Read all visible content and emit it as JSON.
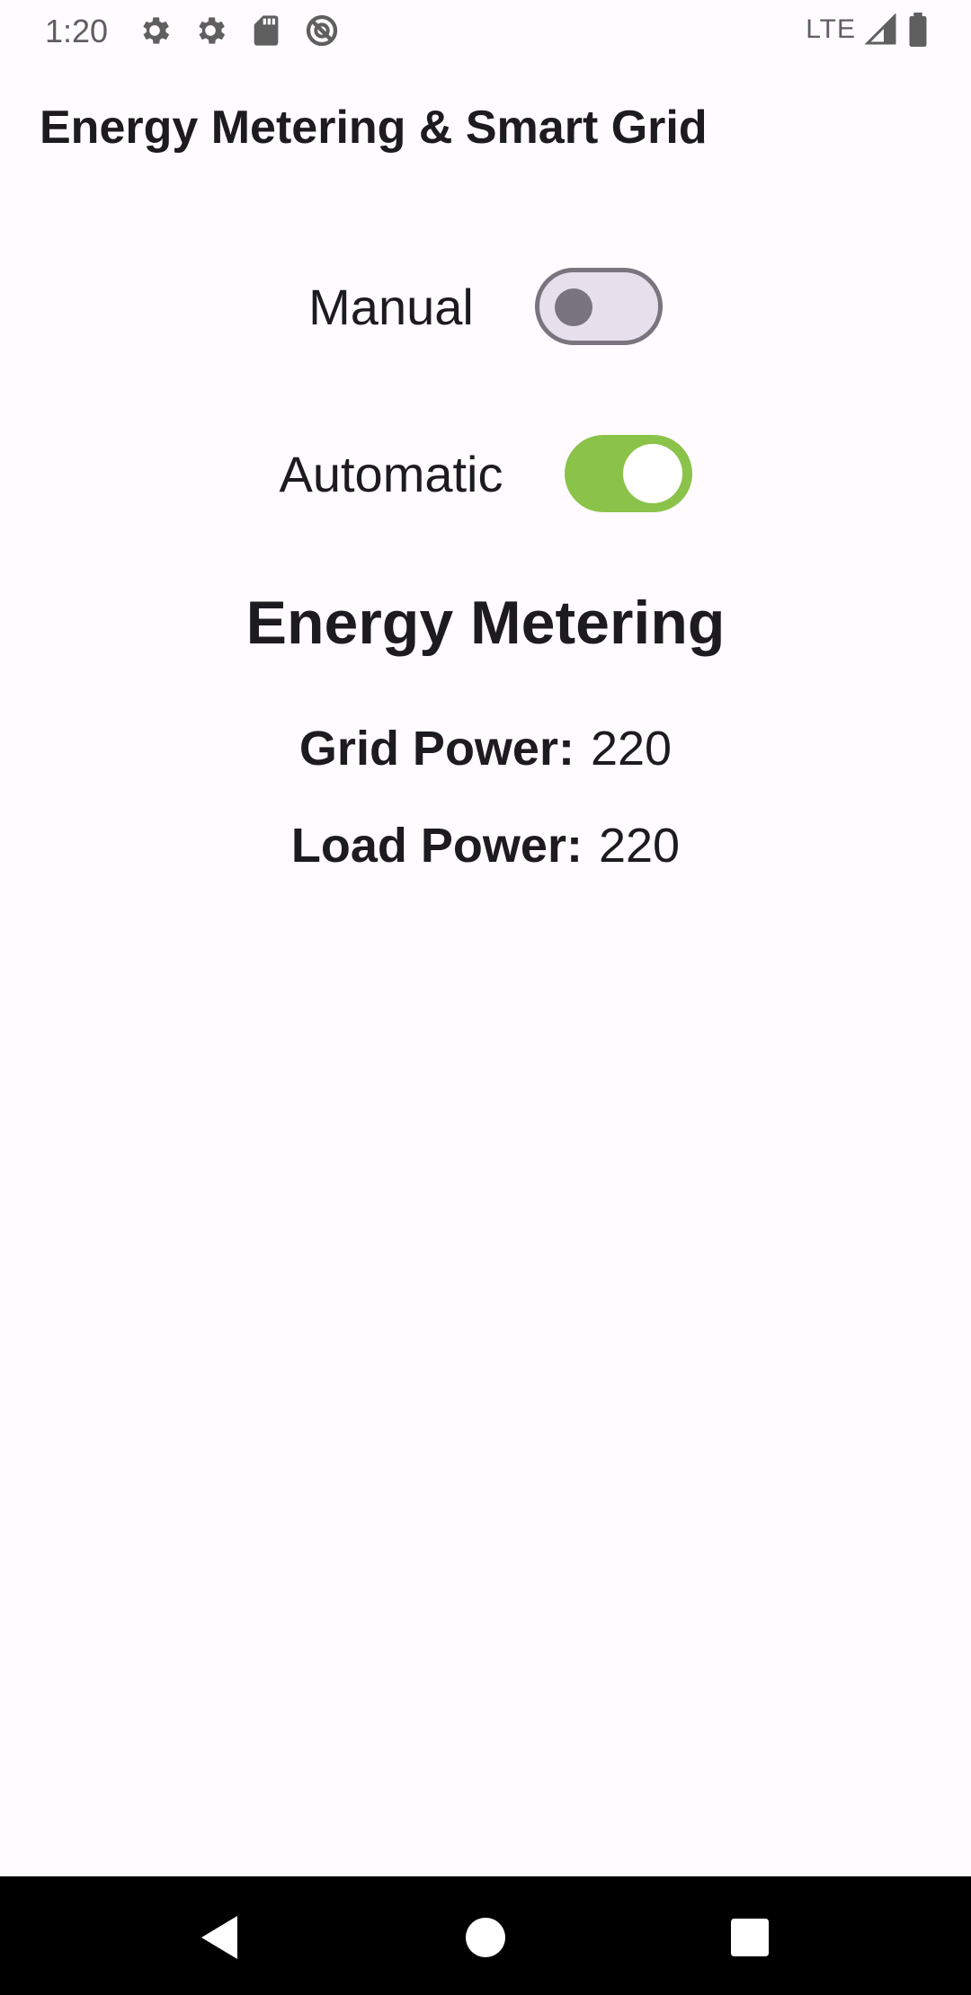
{
  "status_bar": {
    "time": "1:20",
    "network": "LTE",
    "icons": [
      "gear-icon",
      "gear-icon",
      "sd-card-icon",
      "no-sync-icon",
      "signal-icon",
      "battery-icon"
    ]
  },
  "app_bar": {
    "title": "Energy Metering & Smart Grid"
  },
  "controls": {
    "manual": {
      "label": "Manual",
      "checked": false
    },
    "automatic": {
      "label": "Automatic",
      "checked": true
    }
  },
  "metering": {
    "title": "Energy Metering",
    "grid_power_label": "Grid Power:",
    "grid_power_value": "220",
    "load_power_label": "Load Power:",
    "load_power_value": "220"
  },
  "colors": {
    "switch_on": "#8bc34a",
    "switch_off_track": "#e7e0ec",
    "switch_off_outline": "#79747e",
    "background": "#fffbfe"
  },
  "nav_bar": {
    "buttons": [
      "back-icon",
      "home-icon",
      "recents-icon"
    ]
  }
}
